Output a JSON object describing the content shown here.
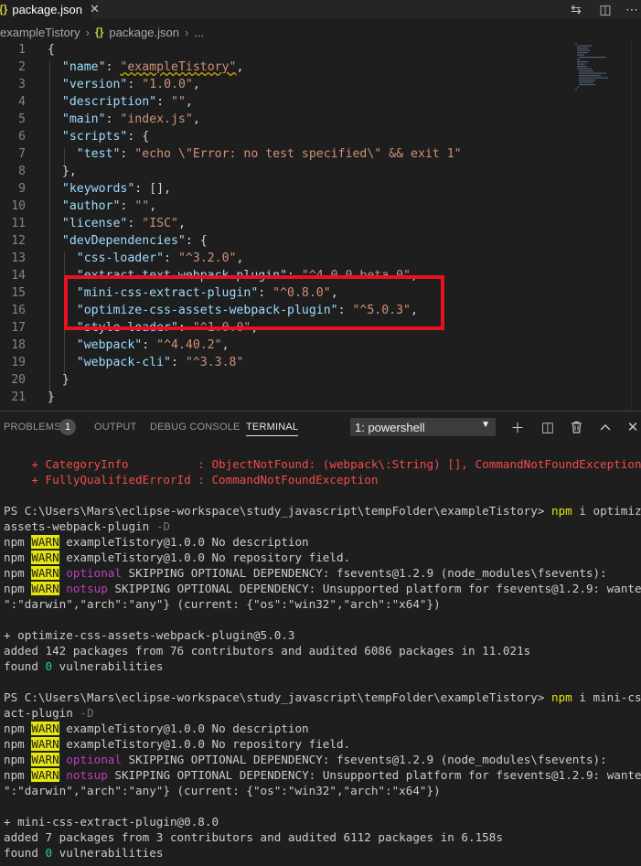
{
  "tab": {
    "title": "package.json",
    "icon": "json-braces-icon"
  },
  "breadcrumb": {
    "folder": "exampleTistory",
    "file": "package.json",
    "more": "..."
  },
  "editor": {
    "line_numbers": [
      "1",
      "2",
      "3",
      "4",
      "5",
      "6",
      "7",
      "8",
      "9",
      "10",
      "11",
      "12",
      "13",
      "14",
      "15",
      "16",
      "17",
      "18",
      "19",
      "20",
      "21"
    ],
    "lines": {
      "l1": "{",
      "l2_key": "\"name\"",
      "l2_val": "\"exampleTistory\"",
      "l3_key": "\"version\"",
      "l3_val": "\"1.0.0\"",
      "l4_key": "\"description\"",
      "l4_val": "\"\"",
      "l5_key": "\"main\"",
      "l5_val": "\"index.js\"",
      "l6_key": "\"scripts\"",
      "l7_key": "\"test\"",
      "l7_val": "\"echo \\\"Error: no test specified\\\" && exit 1\"",
      "l8": "},",
      "l9_key": "\"keywords\"",
      "l9_val": "[],",
      "l10_key": "\"author\"",
      "l10_val": "\"\"",
      "l11_key": "\"license\"",
      "l11_val": "\"ISC\"",
      "l12_key": "\"devDependencies\"",
      "l13_key": "\"css-loader\"",
      "l13_val": "\"^3.2.0\"",
      "l14_key": "\"extract-text-webpack-plugin\"",
      "l14_val": "\"^4.0.0-beta.0\"",
      "l15_key": "\"mini-css-extract-plugin\"",
      "l15_val": "\"^0.8.0\"",
      "l16_key": "\"optimize-css-assets-webpack-plugin\"",
      "l16_val": "\"^5.0.3\"",
      "l17_key": "\"style-loader\"",
      "l17_val": "\"^1.0.0\"",
      "l18_key": "\"webpack\"",
      "l18_val": "\"^4.40.2\"",
      "l19_key": "\"webpack-cli\"",
      "l19_val": "\"^3.3.8\"",
      "l20": "}",
      "l21": "}"
    }
  },
  "panel": {
    "tabs": [
      "PROBLEMS",
      "OUTPUT",
      "DEBUG CONSOLE",
      "TERMINAL"
    ],
    "problems_count": "1",
    "terminal_select": "1: powershell"
  },
  "terminal": {
    "err1": "    + CategoryInfo          : ObjectNotFound: (webpack\\:String) [], CommandNotFoundException",
    "err2": "    + FullyQualifiedErrorId : CommandNotFoundException",
    "prompt1": "PS C:\\Users\\Mars\\eclipse-workspace\\study_javascript\\tempFolder\\exampleTistory> ",
    "cmd1a": "npm",
    "cmd1b": " i optimize-css-",
    "cmd1c": "assets-webpack-plugin",
    "cmd1d": " -D",
    "npm": "npm",
    "warn": "WARN",
    "optional": "optional",
    "notsup": "notsup",
    "w_desc": " exampleTistory@1.0.0 No description",
    "w_repo": " exampleTistory@1.0.0 No repository field.",
    "w_opt": " SKIPPING OPTIONAL DEPENDENCY: fsevents@1.2.9 (node_modules\\fsevents):",
    "w_notsup": " SKIPPING OPTIONAL DEPENDENCY: Unsupported platform for fsevents@1.2.9: wanted {\"os",
    "w_notsup2": "\":\"darwin\",\"arch\":\"any\"} (current: {\"os\":\"win32\",\"arch\":\"x64\"})",
    "added1_pkg": "+ optimize-css-assets-webpack-plugin@5.0.3",
    "added1": "added 142 packages from 76 contributors and audited 6086 packages in 11.021s",
    "found_a": "found ",
    "found_n": "0",
    "found_b": " vulnerabilities",
    "prompt2": "PS C:\\Users\\Mars\\eclipse-workspace\\study_javascript\\tempFolder\\exampleTistory> ",
    "cmd2b": " i mini-css-extr",
    "cmd2c": "act-plugin",
    "cmd2d": " -D",
    "added2_pkg": "+ mini-css-extract-plugin@0.8.0",
    "added2": "added 7 packages from 3 contributors and audited 6112 packages in 6.158s"
  }
}
